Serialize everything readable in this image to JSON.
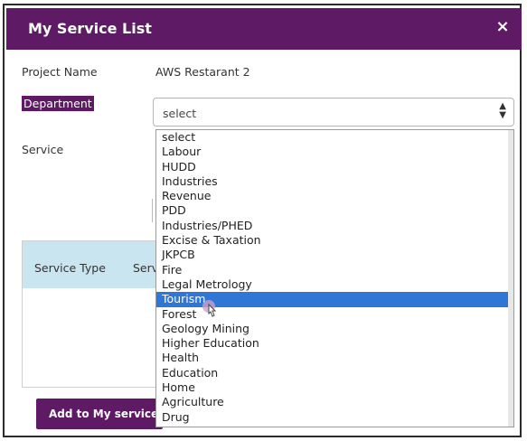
{
  "modal": {
    "title": "My Service List",
    "close_symbol": "×"
  },
  "form": {
    "project_name_label": "Project Name",
    "project_name_value": "AWS Restarant 2",
    "department_label": "Department",
    "department_selected": "select",
    "service_label": "Service"
  },
  "table": {
    "columns": [
      "Service Type",
      "Serv"
    ]
  },
  "actions": {
    "add_label": "Add to My service Li"
  },
  "dropdown": {
    "options": [
      "select",
      "Labour",
      "HUDD",
      "Industries",
      "Revenue",
      "PDD",
      "Industries/PHED",
      "Excise & Taxation",
      "JKPCB",
      "Fire",
      "Legal Metrology",
      "Tourism",
      "Forest",
      "Geology Mining",
      "Higher Education",
      "Health",
      "Education",
      "Home",
      "Agriculture",
      "Drug"
    ],
    "highlighted": "Tourism"
  },
  "icons": {
    "close": "close-icon",
    "select_arrows": "updown-arrows-icon",
    "cursor": "hand-cursor-icon"
  },
  "colors": {
    "brand": "#5e1a64",
    "table_header": "#c9e5ef",
    "highlight": "#2f77d6"
  }
}
